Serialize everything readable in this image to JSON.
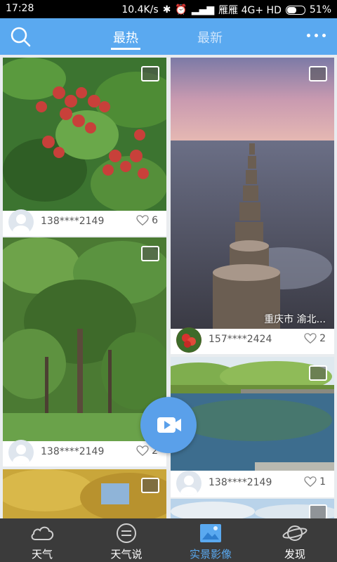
{
  "status_bar": {
    "time": "17:28",
    "speed": "10.4K/s",
    "carrier": "雁雁 4G+ HD",
    "battery": "51%"
  },
  "header": {
    "tabs": [
      {
        "label": "最热",
        "active": true
      },
      {
        "label": "最新",
        "active": false
      }
    ]
  },
  "feed": {
    "posts": [
      {
        "user": "138****2149",
        "likes": "6",
        "caption": ""
      },
      {
        "user": "157****2424",
        "likes": "2",
        "caption": "重庆市 渝北..."
      },
      {
        "user": "138****2149",
        "likes": "2",
        "caption": ""
      },
      {
        "user": "138****2149",
        "likes": "1",
        "caption": ""
      }
    ]
  },
  "bottom_nav": {
    "items": [
      {
        "label": "天气",
        "icon": "cloud-icon"
      },
      {
        "label": "天气说",
        "icon": "chat-icon"
      },
      {
        "label": "实景影像",
        "icon": "photo-icon",
        "active": true
      },
      {
        "label": "发现",
        "icon": "planet-icon"
      }
    ]
  },
  "colors": {
    "accent": "#5aa9f0",
    "nav_background": "#3b3b3b",
    "header_background": "#5aa9f0"
  }
}
